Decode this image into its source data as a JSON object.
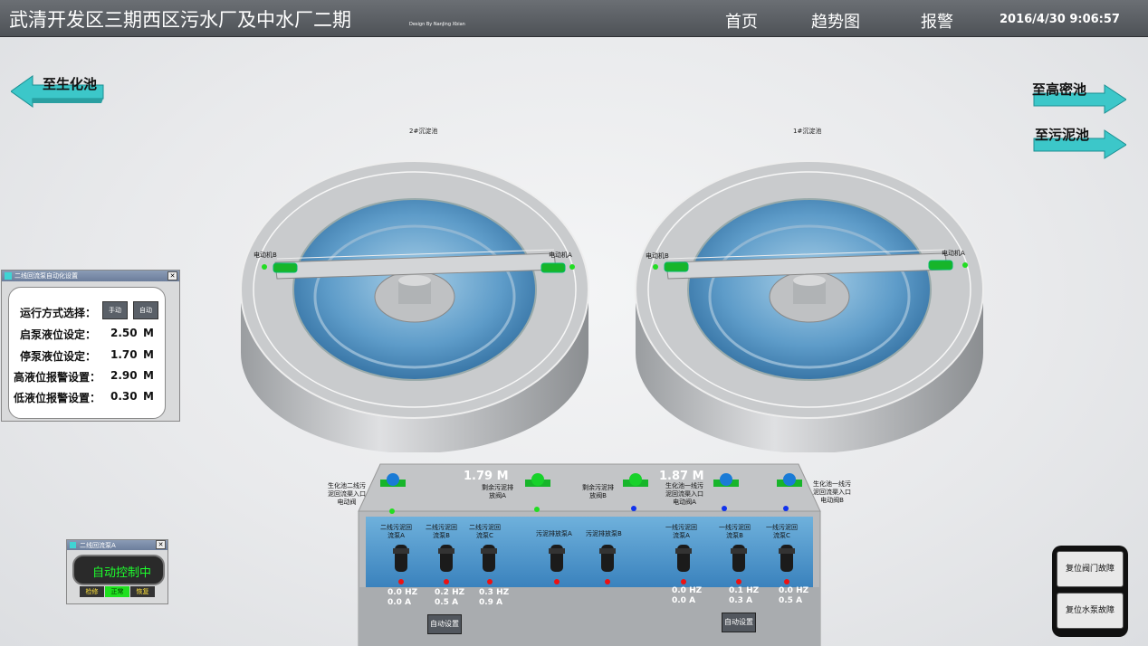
{
  "header": {
    "title": "武清开发区三期西区污水厂及中水厂二期",
    "design": "Design By NanJing Xbian",
    "nav": [
      "首页",
      "趋势图",
      "报警"
    ],
    "datetime": "2016/4/30 9:06:57"
  },
  "links": {
    "to_bio": "至生化池",
    "to_highdensity": "至高密池",
    "to_sludge": "至污泥池"
  },
  "tanks": {
    "tank2": {
      "label": "2#沉淀池",
      "motor_b": "电动机B",
      "motor_a": "电动机A"
    },
    "tank1": {
      "label": "1#沉淀池",
      "motor_b": "电动机B",
      "motor_a": "电动机A"
    }
  },
  "settings_window": {
    "title": "二线回流泵自动化设置",
    "mode_label": "运行方式选择：",
    "manual": "手动",
    "auto": "自动",
    "start_level": {
      "label": "启泵液位设定：",
      "value": "2.50",
      "unit": "M"
    },
    "stop_level": {
      "label": "停泵液位设定：",
      "value": "1.70",
      "unit": "M"
    },
    "high_alarm": {
      "label": "高液位报警设置：",
      "value": "2.90",
      "unit": "M"
    },
    "low_alarm": {
      "label": "低液位报警设置：",
      "value": "0.30",
      "unit": "M"
    }
  },
  "pump_window": {
    "title": "二线回流泵A",
    "status": "自动控制中",
    "buttons": [
      "检修",
      "正常",
      "恢复"
    ]
  },
  "basin": {
    "valve_left": "生化池二线污\n泥回流渠入口\n电动阀",
    "valve_excess_a": "剩余污泥排\n放阀A",
    "valve_excess_b": "剩余污泥排\n放阀B",
    "valve_line1_a": "生化池一线污\n泥回流渠入口\n电动阀A",
    "valve_line1_b": "生化池一线污\n泥回流渠入口\n电动阀B",
    "level_left": "1.79  M",
    "level_right": "1.87  M",
    "pumps": [
      {
        "label": "二线污泥回\n流泵A",
        "hz": "0.0  HZ",
        "a": "0.0    A"
      },
      {
        "label": "二线污泥回\n流泵B",
        "hz": "0.2  HZ",
        "a": "0.5    A"
      },
      {
        "label": "二线污泥回\n流泵C",
        "hz": "0.3  HZ",
        "a": "0.9    A"
      },
      {
        "label": "污泥排放泵A",
        "hz": "",
        "a": ""
      },
      {
        "label": "污泥排放泵B",
        "hz": "",
        "a": ""
      },
      {
        "label": "一线污泥回\n流泵A",
        "hz": "0.0  HZ",
        "a": "0.0    A"
      },
      {
        "label": "一线污泥回\n流泵B",
        "hz": "0.1  HZ",
        "a": "0.3    A"
      },
      {
        "label": "一线污泥回\n流泵C",
        "hz": "0.0  HZ",
        "a": "0.5    A"
      }
    ],
    "auto_setting": "自动设置"
  },
  "reset_panel": {
    "valve_fault": "复位阀门故障",
    "pump_fault": "复位水泵故障"
  },
  "colors": {
    "header": "#5a5e63",
    "water": "#5e9cc9",
    "running": "#22dd22",
    "stopped": "#ee1111",
    "valve_blue": "#1133ee",
    "arrow": "#3cc7c9"
  }
}
